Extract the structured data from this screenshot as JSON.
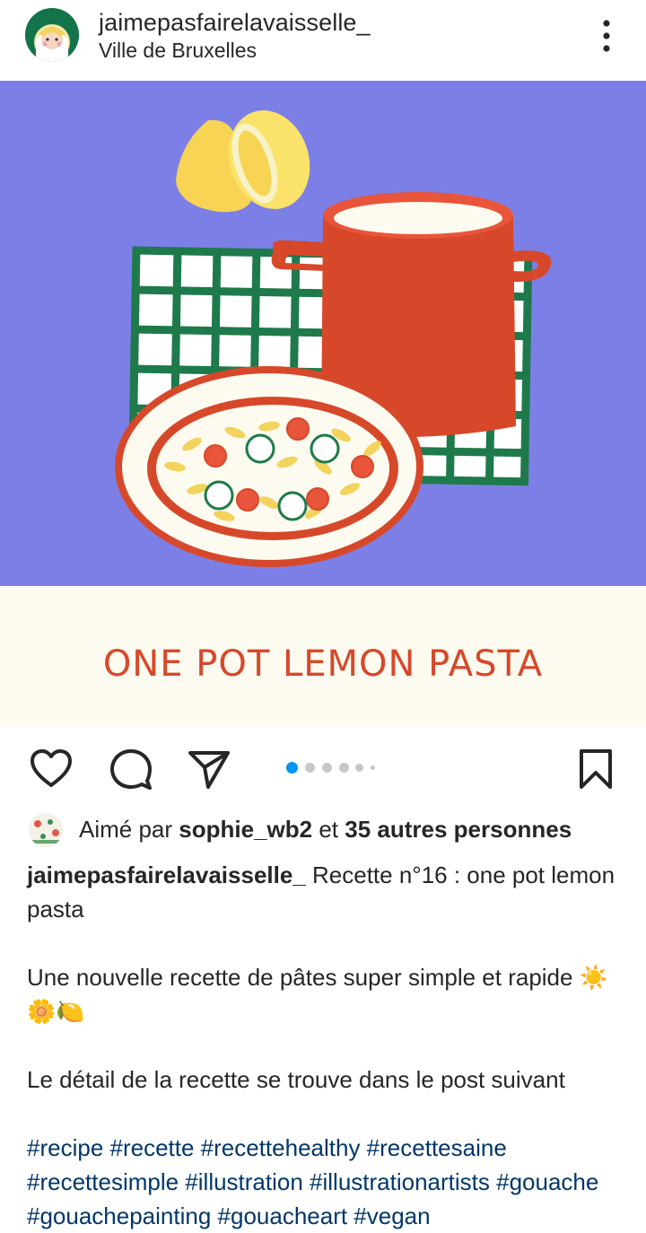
{
  "post": {
    "username": "jaimepasfairelavaisselle_",
    "location": "Ville de Bruxelles",
    "image_title": "ONE POT LEMON PASTA",
    "carousel": {
      "count": 6,
      "active_index": 0
    },
    "likes": {
      "prefix": "Aimé par",
      "user": "sophie_wb2",
      "joiner": "et",
      "others": "35 autres personnes"
    },
    "caption": {
      "username": "jaimepasfairelavaisselle_",
      "line1": " Recette n°16 : one pot lemon pasta",
      "para2": "Une nouvelle recette de pâtes super simple et rapide",
      "emojis": "☀️🌼🍋",
      "para3": "Le détail de la recette se trouve dans le post suivant",
      "hashtags": "#recipe #recette #recettehealthy #recettesaine #recettesimple #illustration #illustrationartists #gouache #gouachepainting #gouacheart #vegan"
    }
  },
  "icons": {
    "more": "more-vertical-icon",
    "like": "heart-icon",
    "comment": "comment-icon",
    "share": "send-icon",
    "save": "bookmark-icon"
  },
  "colors": {
    "background_blue": "#7c80e6",
    "pot_red": "#d7482a",
    "check_green": "#1e7a4a",
    "lemon_yellow": "#f8d455",
    "cream": "#fdfbf0",
    "hashtag": "#00376b",
    "carousel_active": "#0095f6"
  }
}
